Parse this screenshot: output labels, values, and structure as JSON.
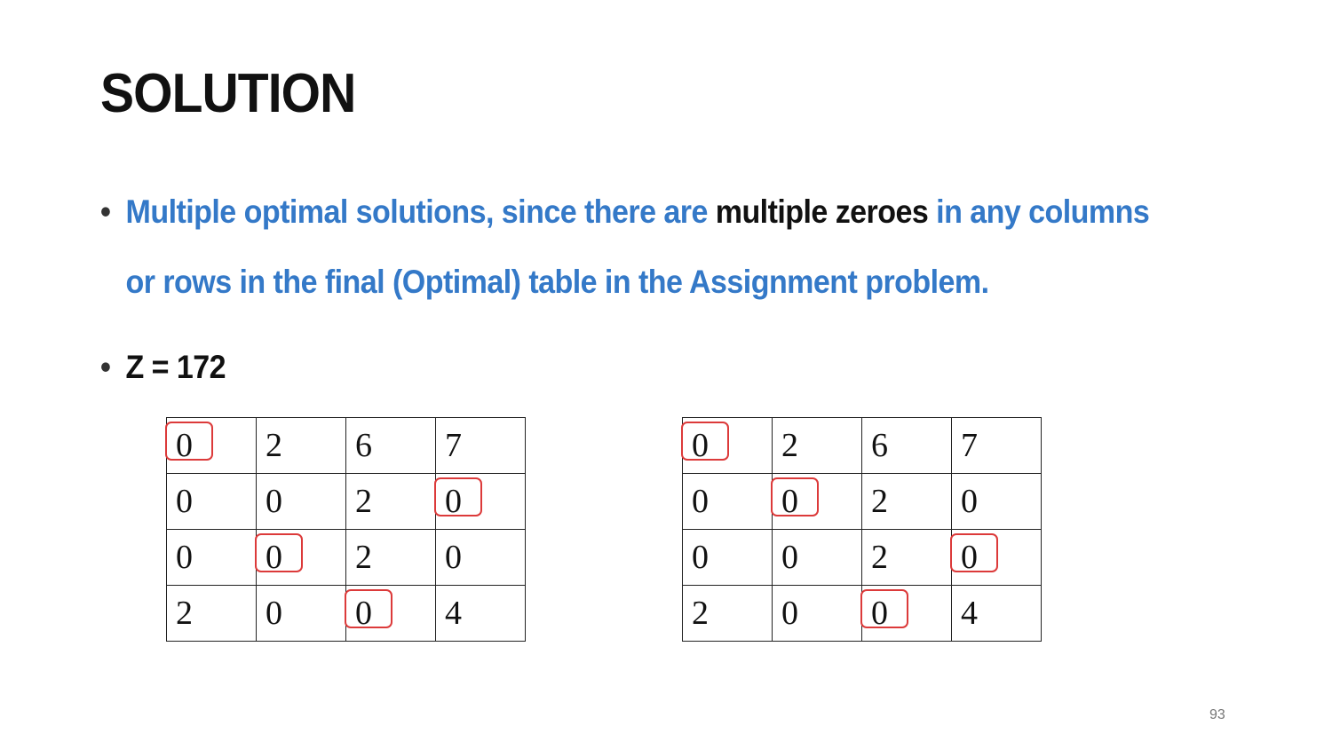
{
  "title": "SOLUTION",
  "bullets": {
    "first": {
      "part1": "Multiple optimal solutions, since there are ",
      "part2": "multiple zeroes",
      "part3": " in any columns",
      "part4": "or rows in the final (Optimal) table in the Assignment problem."
    },
    "second": "Z = 172"
  },
  "bullet_glyph": "•",
  "colors": {
    "text_blue": "#3479c8",
    "text_dark": "#111111",
    "highlight_red": "#dc3a3a"
  },
  "matrices": [
    {
      "rows": [
        [
          "0",
          "2",
          "6",
          "7"
        ],
        [
          "0",
          "0",
          "2",
          "0"
        ],
        [
          "0",
          "0",
          "2",
          "0"
        ],
        [
          "2",
          "0",
          "0",
          "4"
        ]
      ],
      "highlighted": [
        [
          0,
          0
        ],
        [
          1,
          3
        ],
        [
          2,
          1
        ],
        [
          3,
          2
        ]
      ]
    },
    {
      "rows": [
        [
          "0",
          "2",
          "6",
          "7"
        ],
        [
          "0",
          "0",
          "2",
          "0"
        ],
        [
          "0",
          "0",
          "2",
          "0"
        ],
        [
          "2",
          "0",
          "0",
          "4"
        ]
      ],
      "highlighted": [
        [
          0,
          0
        ],
        [
          1,
          1
        ],
        [
          2,
          3
        ],
        [
          3,
          2
        ]
      ]
    }
  ],
  "page_number": "93"
}
